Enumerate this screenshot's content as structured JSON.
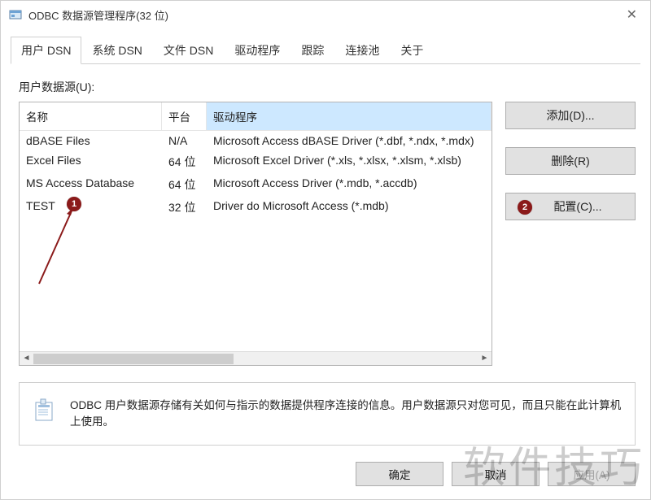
{
  "window": {
    "title": "ODBC 数据源管理程序(32 位)",
    "close_symbol": "✕"
  },
  "tabs": [
    {
      "label": "用户 DSN",
      "active": true
    },
    {
      "label": "系统 DSN",
      "active": false
    },
    {
      "label": "文件 DSN",
      "active": false
    },
    {
      "label": "驱动程序",
      "active": false
    },
    {
      "label": "跟踪",
      "active": false
    },
    {
      "label": "连接池",
      "active": false
    },
    {
      "label": "关于",
      "active": false
    }
  ],
  "section_label": "用户数据源(U):",
  "columns": {
    "name": "名称",
    "platform": "平台",
    "driver": "驱动程序"
  },
  "rows": [
    {
      "name": "dBASE Files",
      "platform": "N/A",
      "driver": "Microsoft Access dBASE Driver (*.dbf, *.ndx, *.mdx)"
    },
    {
      "name": "Excel Files",
      "platform": "64 位",
      "driver": "Microsoft Excel Driver (*.xls, *.xlsx, *.xlsm, *.xlsb)"
    },
    {
      "name": "MS Access Database",
      "platform": "64 位",
      "driver": "Microsoft Access Driver (*.mdb, *.accdb)"
    },
    {
      "name": "TEST",
      "platform": "32 位",
      "driver": "Driver do Microsoft Access (*.mdb)"
    }
  ],
  "buttons": {
    "add": "添加(D)...",
    "remove": "删除(R)",
    "configure": "配置(C)..."
  },
  "info_text": "ODBC 用户数据源存储有关如何与指示的数据提供程序连接的信息。用户数据源只对您可见，而且只能在此计算机上使用。",
  "footer": {
    "ok": "确定",
    "cancel": "取消",
    "apply": "应用(A)"
  },
  "annotations": {
    "marker1": "1",
    "marker2": "2"
  },
  "watermark": "软件技巧",
  "scroll": {
    "left": "◄",
    "right": "►"
  }
}
